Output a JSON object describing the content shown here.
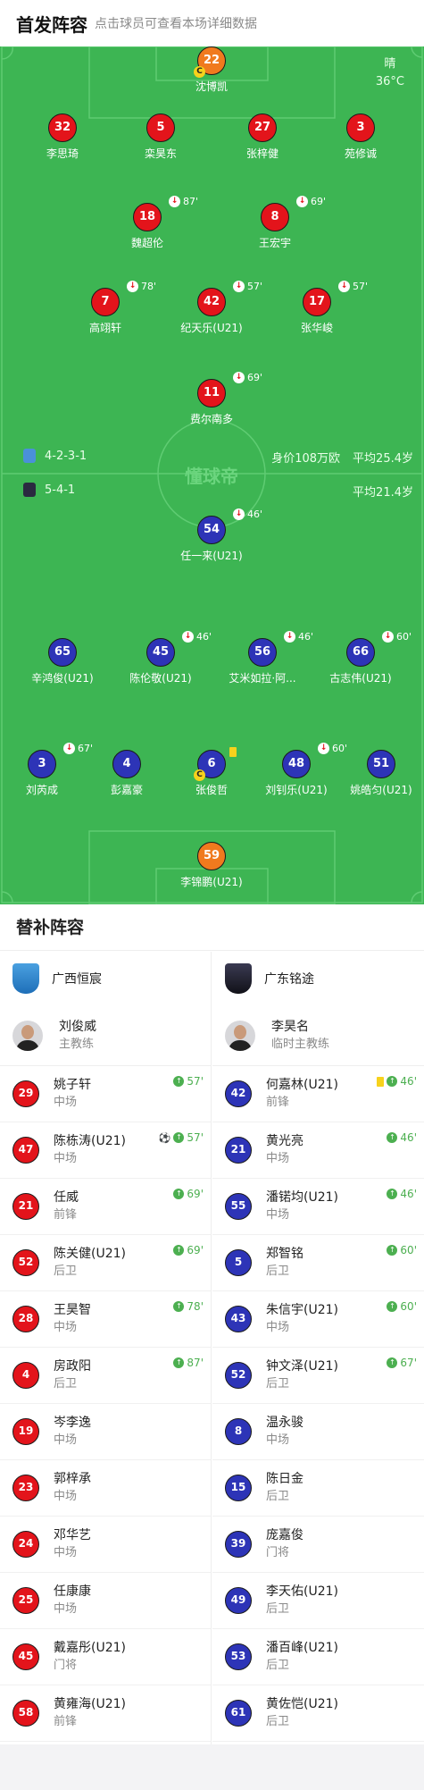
{
  "header": {
    "title": "首发阵容",
    "hint": "点击球员可查看本场详细数据"
  },
  "weather": {
    "condition": "晴",
    "temperature": "36°C"
  },
  "watermark": "懂球帝",
  "home_bar": {
    "formation": "4-2-3-1",
    "value": "身价108万欧",
    "age": "平均25.4岁"
  },
  "away_bar": {
    "formation": "5-4-1",
    "age": "平均21.4岁"
  },
  "home_players": [
    {
      "num": "22",
      "name": "沈博凯",
      "captain": "C"
    },
    {
      "num": "32",
      "name": "李思琦"
    },
    {
      "num": "5",
      "name": "栾昊东"
    },
    {
      "num": "27",
      "name": "张梓健"
    },
    {
      "num": "3",
      "name": "苑修诚"
    },
    {
      "num": "18",
      "name": "魏超伦",
      "sub": "87'"
    },
    {
      "num": "8",
      "name": "王宏宇",
      "sub": "69'"
    },
    {
      "num": "7",
      "name": "高翊轩",
      "sub": "78'"
    },
    {
      "num": "42",
      "name": "纪天乐(U21)",
      "sub": "57'"
    },
    {
      "num": "17",
      "name": "张华峻",
      "sub": "57'"
    },
    {
      "num": "11",
      "name": "费尔南多",
      "sub": "69'"
    }
  ],
  "away_players": [
    {
      "num": "54",
      "name": "任一来(U21)",
      "sub": "46'"
    },
    {
      "num": "65",
      "name": "辛鸿俊(U21)"
    },
    {
      "num": "45",
      "name": "陈伦敬(U21)",
      "sub": "46'"
    },
    {
      "num": "56",
      "name": "艾米如拉·阿...",
      "sub": "46'"
    },
    {
      "num": "66",
      "name": "古志伟(U21)",
      "sub": "60'"
    },
    {
      "num": "3",
      "name": "刘芮成",
      "sub": "67'"
    },
    {
      "num": "4",
      "name": "彭嘉豪"
    },
    {
      "num": "6",
      "name": "张俊哲",
      "captain": "C"
    },
    {
      "num": "48",
      "name": "刘钊乐(U21)",
      "sub": "60'"
    },
    {
      "num": "51",
      "name": "姚皓匀(U21)"
    },
    {
      "num": "59",
      "name": "李锦鹏(U21)"
    }
  ],
  "subs": {
    "title": "替补阵容",
    "home": {
      "team": "广西恒宸",
      "coach": {
        "name": "刘俊威",
        "role": "主教练"
      },
      "players": [
        {
          "num": "29",
          "name": "姚子轩",
          "pos": "中场",
          "min": "57'"
        },
        {
          "num": "47",
          "name": "陈栋涛(U21)",
          "pos": "中场",
          "min": "57'",
          "goal": "⚽"
        },
        {
          "num": "21",
          "name": "任威",
          "pos": "前锋",
          "min": "69'"
        },
        {
          "num": "52",
          "name": "陈关健(U21)",
          "pos": "后卫",
          "min": "69'"
        },
        {
          "num": "28",
          "name": "王昊智",
          "pos": "中场",
          "min": "78'"
        },
        {
          "num": "4",
          "name": "房政阳",
          "pos": "后卫",
          "min": "87'"
        },
        {
          "num": "19",
          "name": "岑李逸",
          "pos": "中场"
        },
        {
          "num": "23",
          "name": "郭梓承",
          "pos": "中场"
        },
        {
          "num": "24",
          "name": "邓华艺",
          "pos": "中场"
        },
        {
          "num": "25",
          "name": "任康康",
          "pos": "中场"
        },
        {
          "num": "45",
          "name": "戴嘉彤(U21)",
          "pos": "门将"
        },
        {
          "num": "58",
          "name": "黄雍海(U21)",
          "pos": "前锋"
        }
      ]
    },
    "away": {
      "team": "广东铭途",
      "coach": {
        "name": "李昊名",
        "role": "临时主教练"
      },
      "players": [
        {
          "num": "42",
          "name": "何嘉林(U21)",
          "pos": "前锋",
          "min": "46'",
          "card": true
        },
        {
          "num": "21",
          "name": "黄光亮",
          "pos": "中场",
          "min": "46'"
        },
        {
          "num": "55",
          "name": "潘锘均(U21)",
          "pos": "中场",
          "min": "46'"
        },
        {
          "num": "5",
          "name": "郑智铭",
          "pos": "后卫",
          "min": "60'"
        },
        {
          "num": "43",
          "name": "朱信宇(U21)",
          "pos": "中场",
          "min": "60'"
        },
        {
          "num": "52",
          "name": "钟文泽(U21)",
          "pos": "后卫",
          "min": "67'"
        },
        {
          "num": "8",
          "name": "温永骏",
          "pos": "中场"
        },
        {
          "num": "15",
          "name": "陈日金",
          "pos": "后卫"
        },
        {
          "num": "39",
          "name": "庞嘉俊",
          "pos": "门将"
        },
        {
          "num": "49",
          "name": "李天佑(U21)",
          "pos": "后卫"
        },
        {
          "num": "53",
          "name": "潘百峰(U21)",
          "pos": "后卫"
        },
        {
          "num": "61",
          "name": "黄佐恺(U21)",
          "pos": "后卫"
        }
      ]
    }
  },
  "colors": {
    "pitch": "#3db553",
    "home": "#e3141b",
    "away": "#2d34b7",
    "keeper": "#f07a1e",
    "sub_in": "#4caf50"
  }
}
